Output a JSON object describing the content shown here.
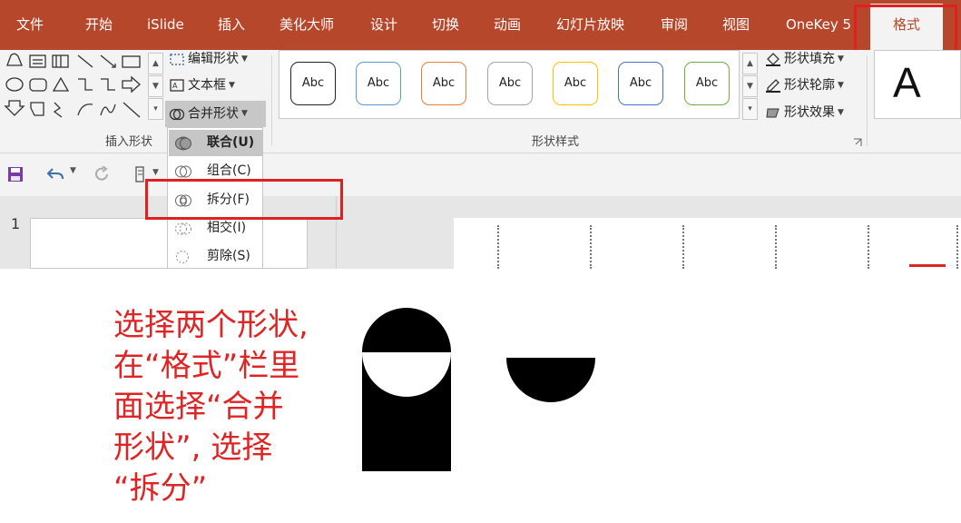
{
  "ribbon": {
    "tabs": [
      "文件",
      "开始",
      "iSlide",
      "插入",
      "美化大师",
      "设计",
      "切换",
      "动画",
      "幻灯片放映",
      "审阅",
      "视图",
      "OneKey 5",
      "格式"
    ],
    "active_tab": "格式",
    "insert_shapes": {
      "edit_shape": "编辑形状",
      "text_box": "文本框",
      "merge_shapes": "合并形状",
      "group_label": "插入形状"
    },
    "shape_styles": {
      "sample_text": "Abc",
      "swatch_colors": [
        "#222222",
        "#5b9bd5",
        "#ed7d31",
        "#a5a5a5",
        "#ffc000",
        "#4472c4",
        "#70ad47"
      ],
      "group_label": "形状样式",
      "fill": "形状填充",
      "outline": "形状轮廓",
      "effects": "形状效果"
    },
    "wordart_sample": "A"
  },
  "merge_menu": {
    "items": [
      {
        "label": "联合(U)",
        "highlighted": true
      },
      {
        "label": "组合(C)",
        "highlighted": false
      },
      {
        "label": "拆分(F)",
        "highlighted": false
      },
      {
        "label": "相交(I)",
        "highlighted": false
      },
      {
        "label": "剪除(S)",
        "highlighted": false
      }
    ]
  },
  "slide_panel": {
    "slide_number": "1"
  },
  "caption": {
    "lines": [
      "选择两个形状,",
      "在“格式”栏里",
      "面选择“合并",
      "形状”, 选择",
      "“拆分”"
    ]
  },
  "colors": {
    "ribbon_accent": "#b7472a",
    "annotation_red": "#e02020"
  }
}
